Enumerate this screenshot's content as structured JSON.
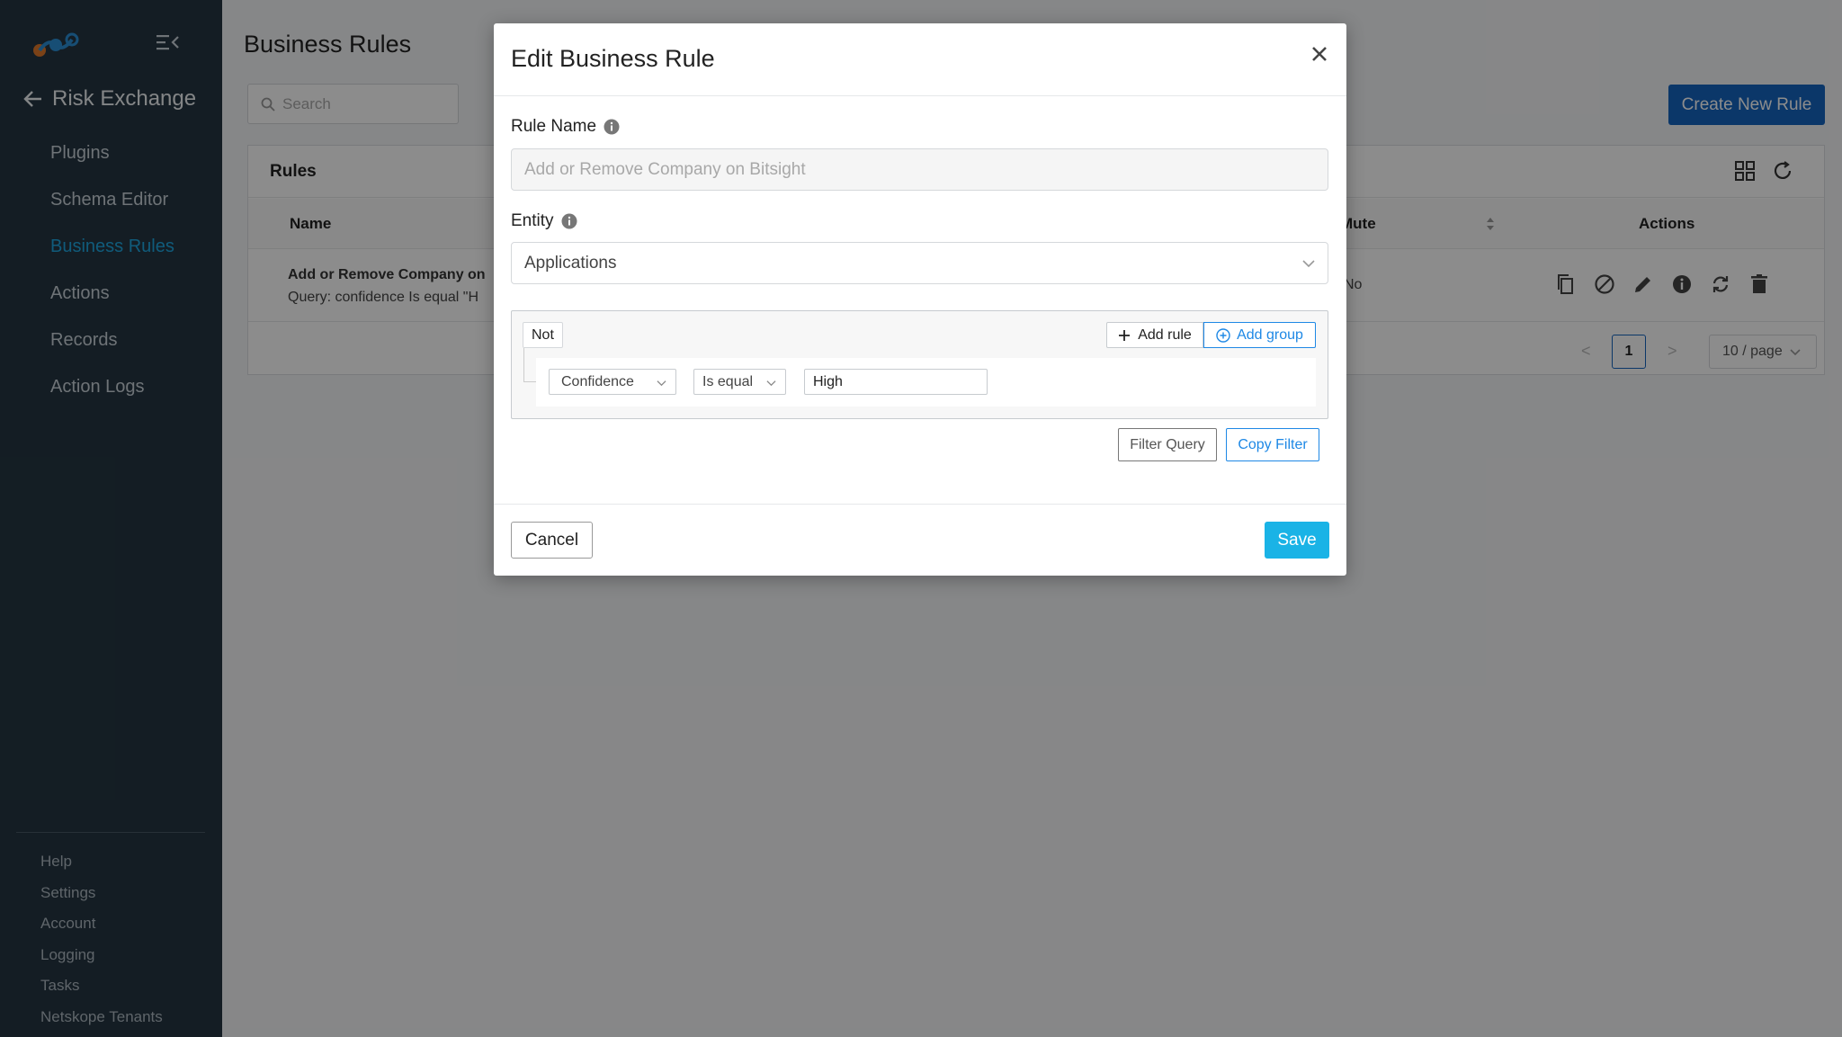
{
  "colors": {
    "sidebar_bg": "#253642",
    "accent": "#1ea7e1",
    "primary_button": "#1565c0",
    "save_button": "#1ab3e6",
    "link_blue": "#1e88e5"
  },
  "sidebar": {
    "back_label": "Risk Exchange",
    "items": [
      {
        "label": "Plugins"
      },
      {
        "label": "Schema Editor"
      },
      {
        "label": "Business Rules",
        "active": true
      },
      {
        "label": "Actions"
      },
      {
        "label": "Records"
      },
      {
        "label": "Action Logs"
      }
    ],
    "bottom_items": [
      {
        "label": "Help"
      },
      {
        "label": "Settings"
      },
      {
        "label": "Account"
      },
      {
        "label": "Logging"
      },
      {
        "label": "Tasks"
      },
      {
        "label": "Netskope Tenants"
      }
    ]
  },
  "page": {
    "title": "Business Rules",
    "search_placeholder": "Search",
    "create_button": "Create New Rule",
    "panel_title": "Rules",
    "columns": {
      "name": "Name",
      "mute": "Mute",
      "actions": "Actions"
    },
    "rows": [
      {
        "name": "Add or Remove Company on",
        "query": "Query: confidence Is equal \"H",
        "mute": "No"
      }
    ],
    "pagination": {
      "prev": "<",
      "current": "1",
      "next": ">",
      "page_size": "10 / page"
    }
  },
  "modal": {
    "title": "Edit Business Rule",
    "rule_name_label": "Rule Name",
    "rule_name_placeholder": "Add or Remove Company on Bitsight",
    "entity_label": "Entity",
    "entity_value": "Applications",
    "query": {
      "not_label": "Not",
      "add_rule": "Add rule",
      "add_group": "Add group",
      "field": "Confidence",
      "operator": "Is equal",
      "value": "High"
    },
    "filter_query_button": "Filter Query",
    "copy_filter_button": "Copy Filter",
    "cancel_button": "Cancel",
    "save_button": "Save"
  }
}
